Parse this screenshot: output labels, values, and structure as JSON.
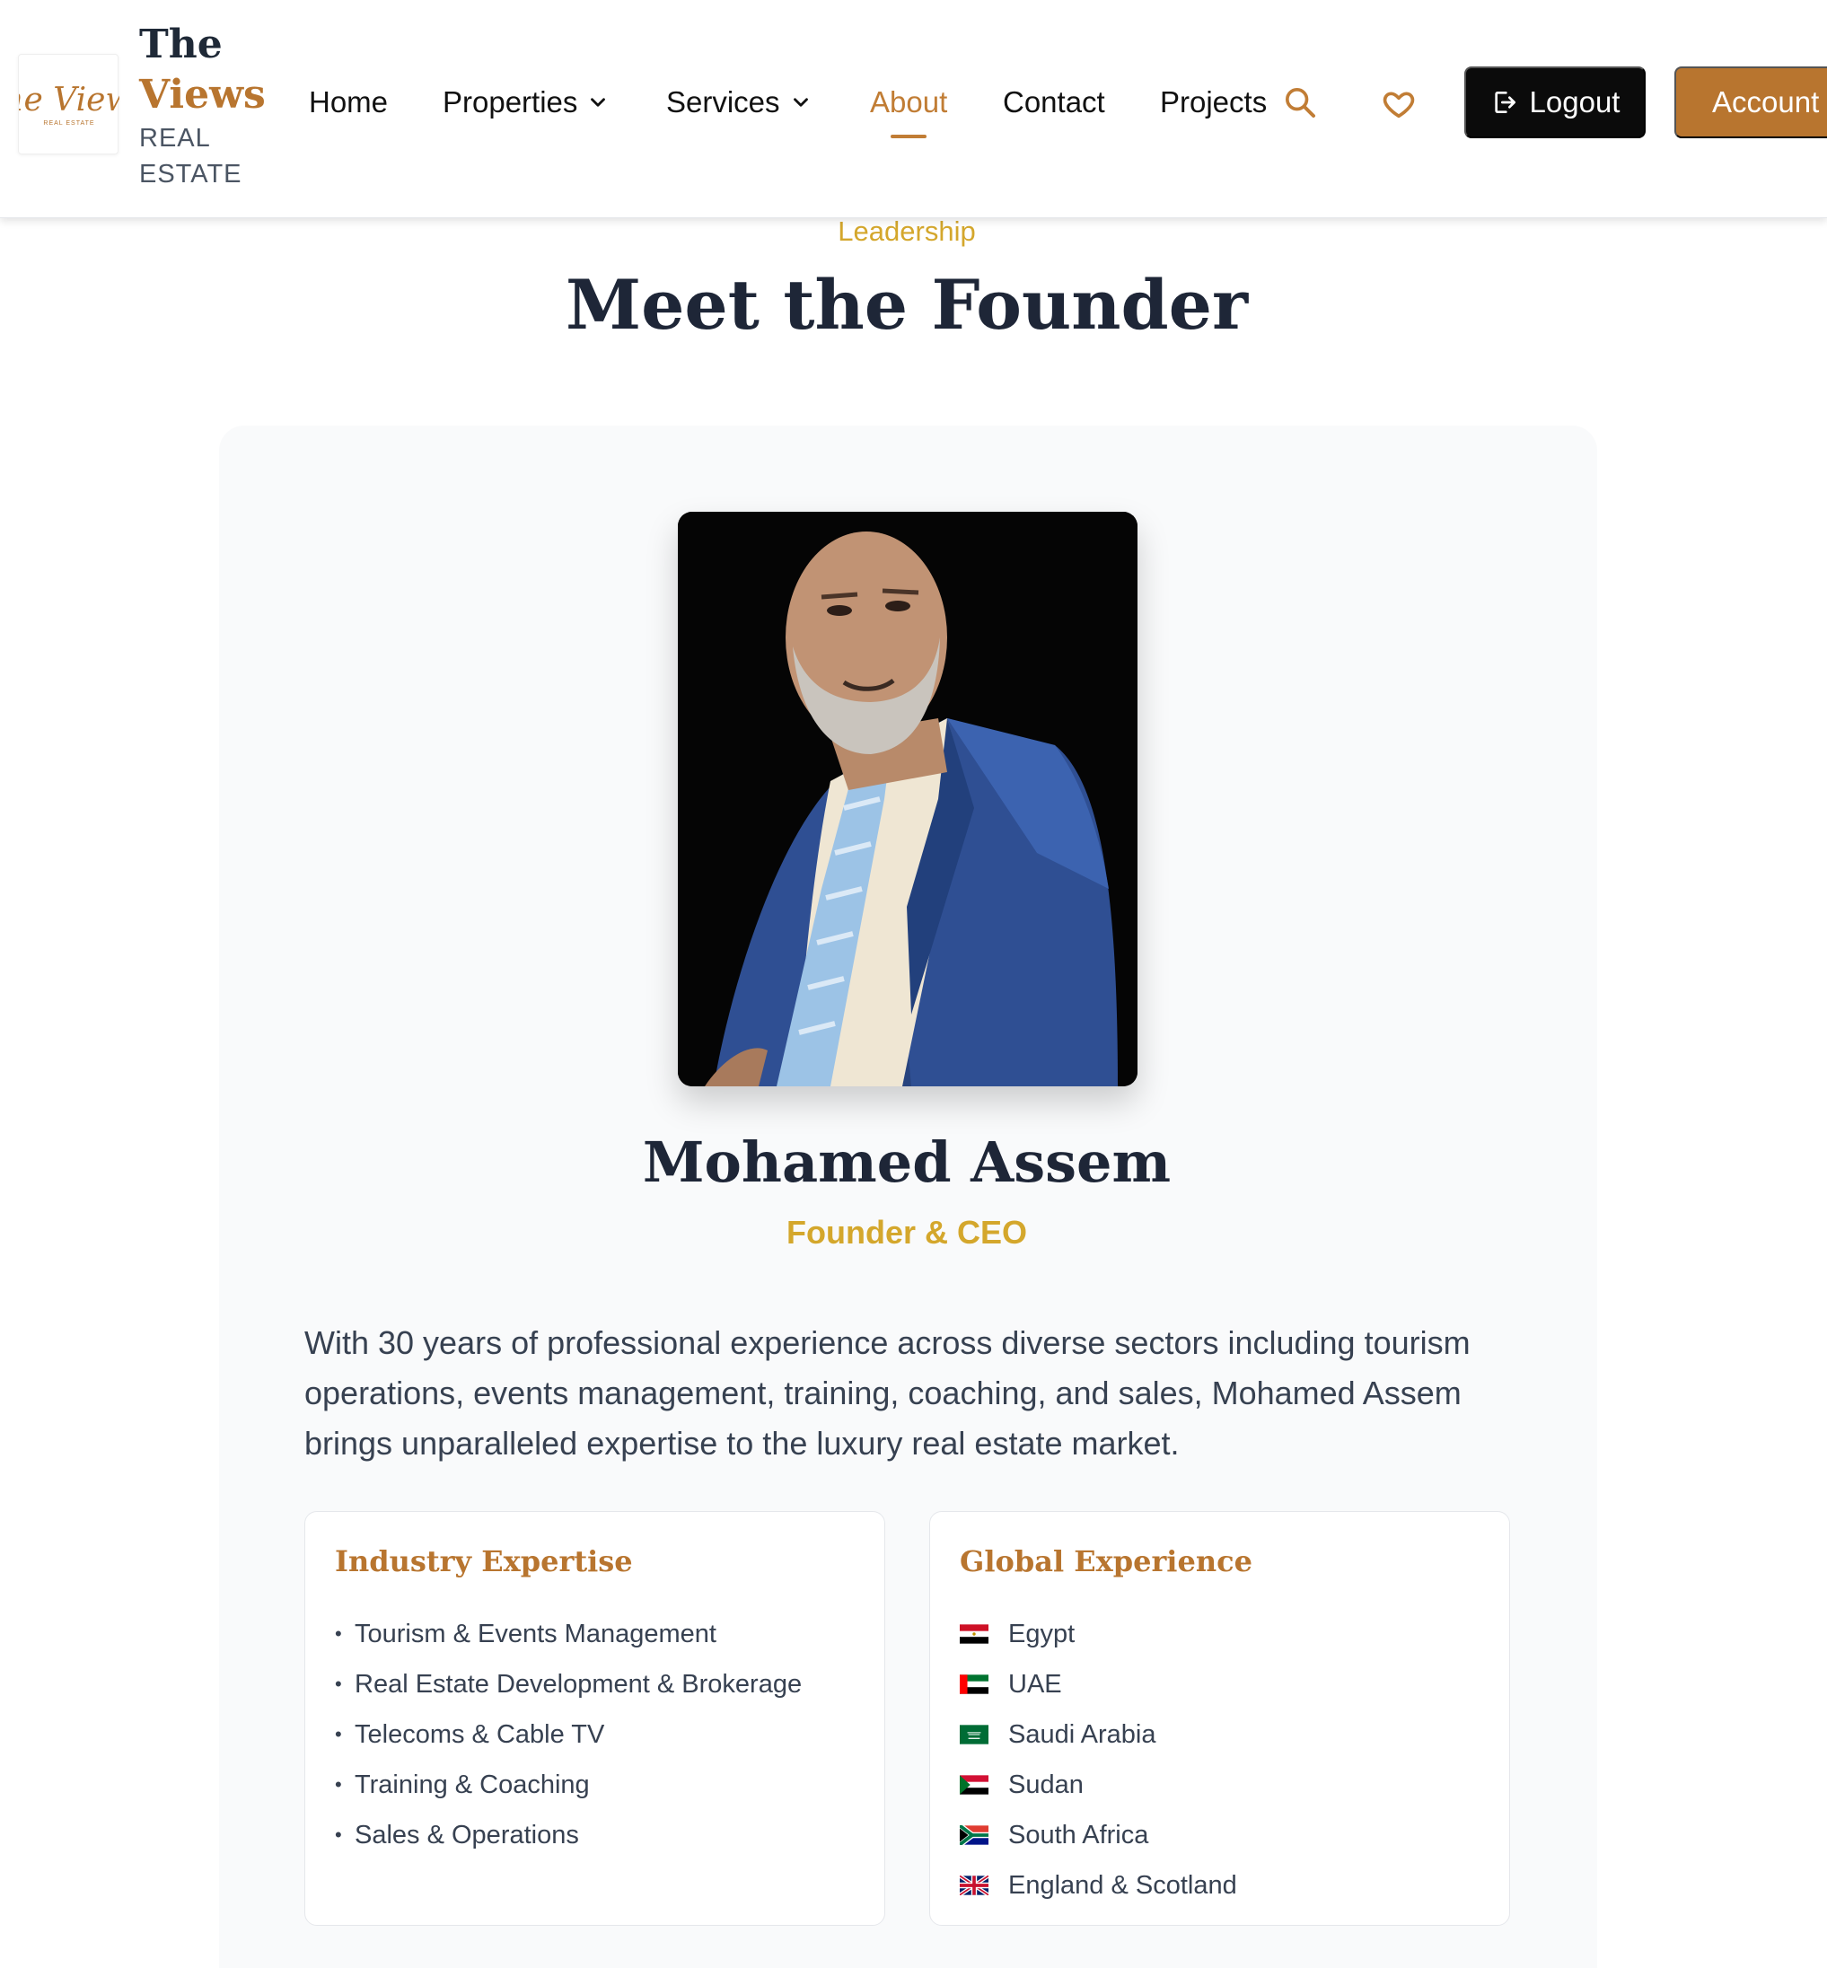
{
  "header": {
    "logo": {
      "line1": "The",
      "line2": "Views",
      "line3": "REAL",
      "line4": "ESTATE",
      "mark_text": "The Views",
      "mark_sub": "REAL ESTATE"
    },
    "nav": [
      {
        "label": "Home"
      },
      {
        "label": "Properties"
      },
      {
        "label": "Services"
      },
      {
        "label": "About",
        "active": true
      },
      {
        "label": "Contact"
      },
      {
        "label": "Projects"
      }
    ],
    "icons": [
      "search-icon",
      "heart-icon",
      "logout-icon",
      "chevron-down-icon"
    ],
    "logout_label": "Logout",
    "account_label": "Account"
  },
  "section": {
    "eyebrow": "Leadership",
    "title": "Meet the Founder"
  },
  "founder": {
    "name": "Mohamed Assem",
    "role": "Founder & CEO",
    "bio": "With 30 years of professional experience across diverse sectors including tourism operations, events management, training, coaching, and sales, Mohamed Assem brings unparalleled expertise to the luxury real estate market."
  },
  "expertise": {
    "title": "Industry Expertise",
    "items": [
      "Tourism & Events Management",
      "Real Estate Development & Brokerage",
      "Telecoms & Cable TV",
      "Training & Coaching",
      "Sales & Operations"
    ]
  },
  "experience": {
    "title": "Global Experience",
    "items": [
      {
        "flag": "egypt-flag-icon",
        "label": "Egypt"
      },
      {
        "flag": "uae-flag-icon",
        "label": "UAE"
      },
      {
        "flag": "saudi-arabia-flag-icon",
        "label": "Saudi Arabia"
      },
      {
        "flag": "sudan-flag-icon",
        "label": "Sudan"
      },
      {
        "flag": "south-africa-flag-icon",
        "label": "South Africa"
      },
      {
        "flag": "uk-flag-icon",
        "label": "England & Scotland"
      }
    ]
  },
  "colors": {
    "accent": "#b8752f",
    "gold": "#d4a72c",
    "heading": "#1e2637",
    "button_dark": "#0b0b0b"
  }
}
